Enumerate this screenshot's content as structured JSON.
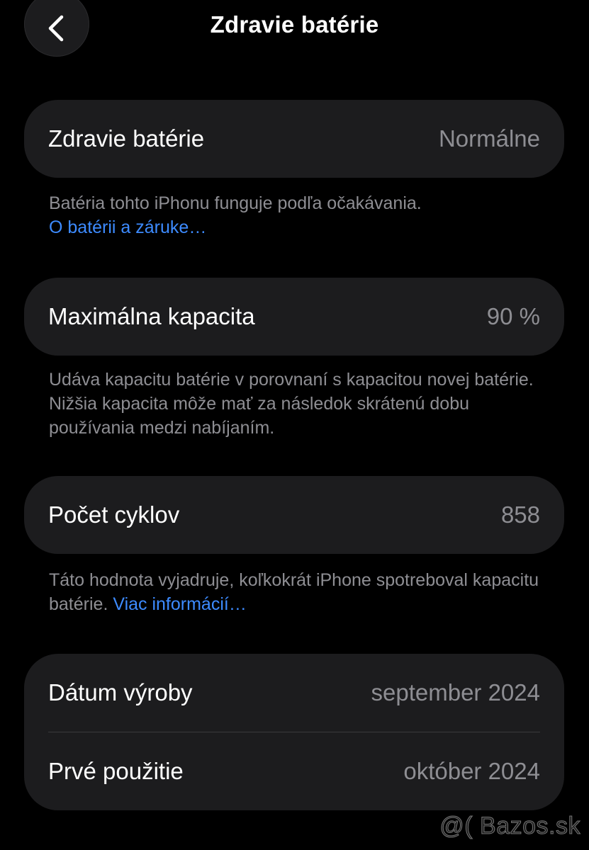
{
  "nav": {
    "title": "Zdravie batérie",
    "back_icon": "chevron-left-icon"
  },
  "health": {
    "label": "Zdravie batérie",
    "value": "Normálne",
    "footnote_text": "Batéria tohto iPhonu funguje podľa očakávania.",
    "footnote_link": "O batérii a záruke…"
  },
  "capacity": {
    "label": "Maximálna kapacita",
    "value": "90 %",
    "footnote_text": "Udáva kapacitu batérie v porovnaní s kapacitou novej batérie. Nižšia kapacita môže mať za následok skrátenú dobu používania medzi nabíjaním."
  },
  "cycles": {
    "label": "Počet cyklov",
    "value": "858",
    "footnote_text": "Táto hodnota vyjadruje, koľkokrát iPhone spotreboval kapacitu batérie.",
    "footnote_link": "Viac informácií…"
  },
  "dates": {
    "manufacture_label": "Dátum výroby",
    "manufacture_value": "september 2024",
    "first_use_label": "Prvé použitie",
    "first_use_value": "október 2024"
  },
  "watermark": "@( Bazos.sk",
  "colors": {
    "background": "#000000",
    "card": "#1c1c1e",
    "secondary_text": "#8e8e93",
    "link": "#3d8bff"
  }
}
